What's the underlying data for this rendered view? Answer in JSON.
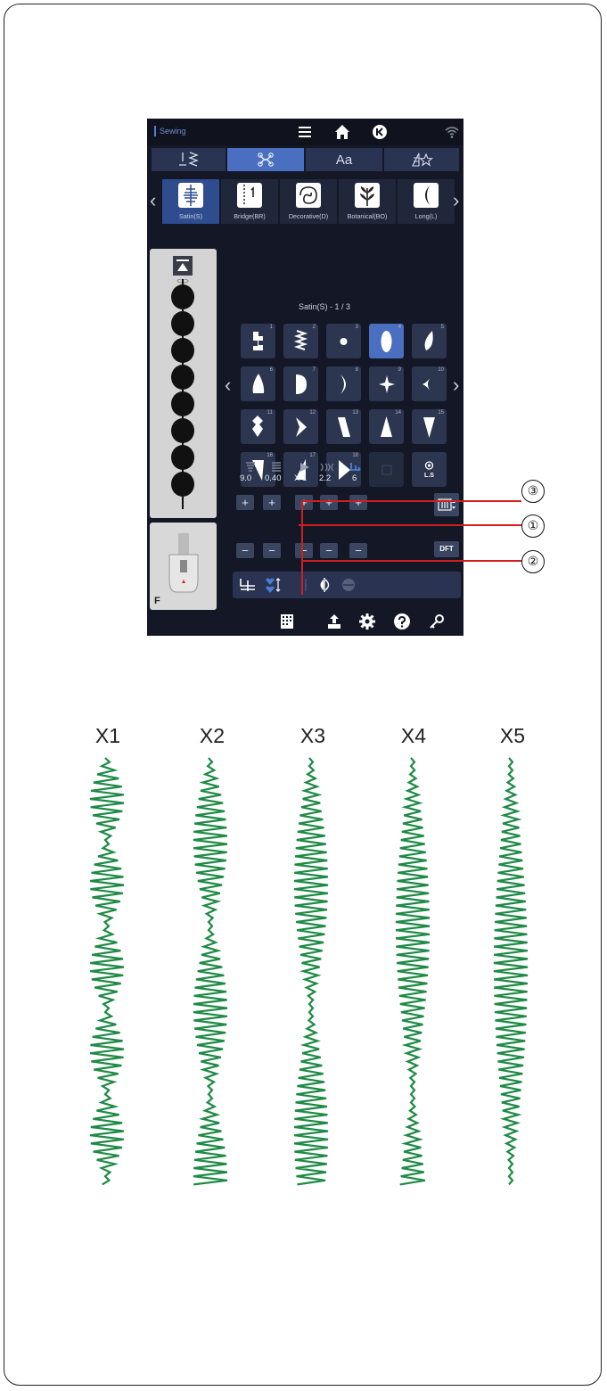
{
  "app": {
    "title": "Sewing"
  },
  "tabs": [
    "",
    "",
    "Aa",
    ""
  ],
  "categories": [
    {
      "label": "Satin(S)"
    },
    {
      "label": "Bridge(BR)"
    },
    {
      "label": "Decorative(D)"
    },
    {
      "label": "Botanical(BO)"
    },
    {
      "label": "Long(L)"
    }
  ],
  "grid": {
    "title": "Satin(S) - 1 / 3",
    "cells": [
      {
        "num": "1"
      },
      {
        "num": "2"
      },
      {
        "num": "3"
      },
      {
        "num": "4"
      },
      {
        "num": "5"
      },
      {
        "num": "6"
      },
      {
        "num": "7"
      },
      {
        "num": "8"
      },
      {
        "num": "9"
      },
      {
        "num": "10"
      },
      {
        "num": "11"
      },
      {
        "num": "12"
      },
      {
        "num": "13"
      },
      {
        "num": "14"
      },
      {
        "num": "15"
      },
      {
        "num": "16"
      },
      {
        "num": "17"
      },
      {
        "num": "18"
      },
      {
        "num": ""
      },
      {
        "num": ""
      }
    ],
    "ls_label": "L.S"
  },
  "params": {
    "width": "9.0",
    "density": "0.40",
    "elongation": "X 1",
    "tension": "2.2",
    "foot_pressure": "6"
  },
  "buttons": {
    "plus": "+",
    "minus": "−",
    "dft": "DFT"
  },
  "foot": {
    "label": "F"
  },
  "callouts": [
    "③",
    "①",
    "②"
  ],
  "examples": [
    "X1",
    "X2",
    "X3",
    "X4",
    "X5"
  ],
  "colors": {
    "accent": "#4a6fc0",
    "stitch": "#1e8a45",
    "screen_bg": "#141826"
  }
}
